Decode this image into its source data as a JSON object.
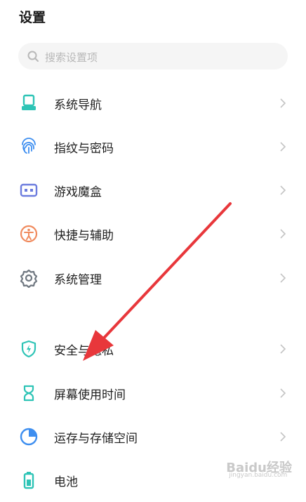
{
  "header": {
    "title": "设置"
  },
  "search": {
    "placeholder": "搜索设置项",
    "icon": "search-icon"
  },
  "items": [
    {
      "label": "系统导航",
      "icon": "navigation-icon",
      "color": "#2ec4b6"
    },
    {
      "label": "指纹与密码",
      "icon": "fingerprint-icon",
      "color": "#3d8ef0"
    },
    {
      "label": "游戏魔盒",
      "icon": "game-box-icon",
      "color": "#6c7cde"
    },
    {
      "label": "快捷与辅助",
      "icon": "accessibility-icon",
      "color": "#f08a5d"
    },
    {
      "label": "系统管理",
      "icon": "gear-icon",
      "color": "#6f7780"
    },
    {
      "label": "安全与隐私",
      "icon": "shield-icon",
      "color": "#2ec4b6"
    },
    {
      "label": "屏幕使用时间",
      "icon": "hourglass-icon",
      "color": "#2ec4b6"
    },
    {
      "label": "运存与存储空间",
      "icon": "storage-pie-icon",
      "color": "#3d8ef0"
    },
    {
      "label": "电池",
      "icon": "battery-icon",
      "color": "#2ec4b6"
    }
  ],
  "annotation": {
    "color": "#e8373b"
  },
  "watermark": {
    "text": "Baidu经验",
    "sub": "jingyan.baidu.com"
  }
}
